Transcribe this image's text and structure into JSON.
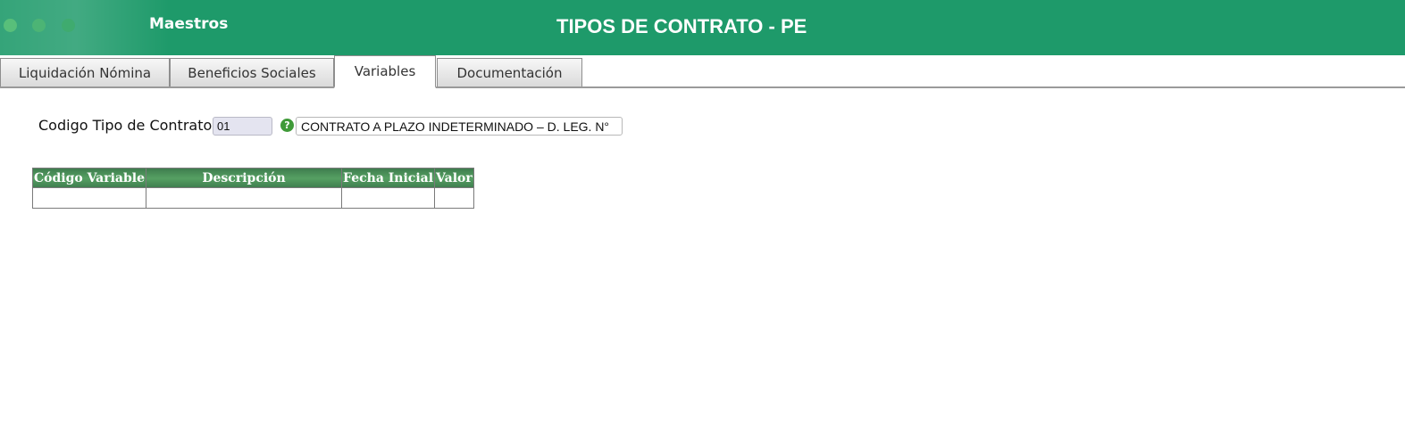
{
  "header": {
    "app_name": "Maestros",
    "page_title": "TIPOS DE CONTRATO - PE",
    "accent_color": "#1e9a6a"
  },
  "tabs": [
    {
      "label": "Liquidación Nómina",
      "active": false
    },
    {
      "label": "Beneficios Sociales",
      "active": false
    },
    {
      "label": "Variables",
      "active": true
    },
    {
      "label": "Documentación",
      "active": false
    }
  ],
  "form": {
    "contract_type_label": "Codigo Tipo de Contrato:",
    "contract_code_value": "01",
    "help_icon": "question-circle-icon",
    "contract_description_value": "CONTRATO A PLAZO INDETERMINADO – D. LEG. N°"
  },
  "variables_table": {
    "columns": [
      "Código Variable",
      "Descripción",
      "Fecha Inicial",
      "Valor"
    ],
    "rows": [
      [
        "",
        "",
        "",
        ""
      ]
    ]
  }
}
